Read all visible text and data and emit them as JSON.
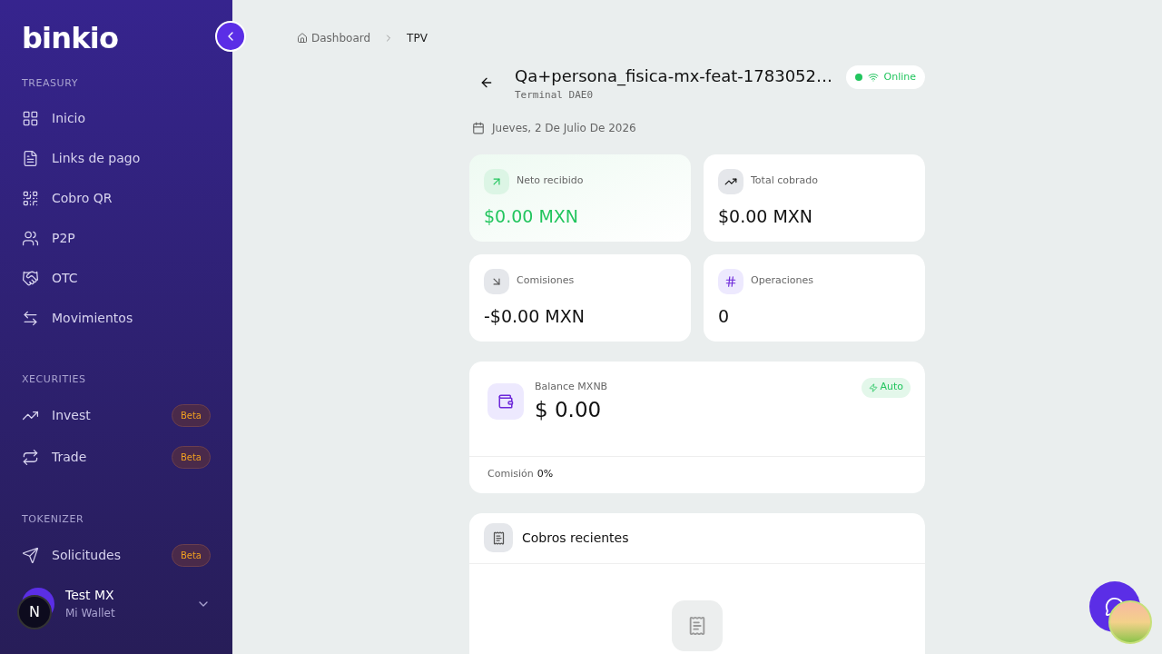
{
  "sidebar": {
    "logo": "binkio",
    "sections": [
      {
        "title": "TREASURY",
        "items": [
          {
            "label": "Inicio"
          },
          {
            "label": "Links de pago"
          },
          {
            "label": "Cobro QR"
          },
          {
            "label": "P2P"
          },
          {
            "label": "OTC"
          },
          {
            "label": "Movimientos"
          }
        ]
      },
      {
        "title": "XECURITIES",
        "items": [
          {
            "label": "Invest",
            "badge": "Beta"
          },
          {
            "label": "Trade",
            "badge": "Beta"
          }
        ]
      },
      {
        "title": "TOKENIZER",
        "items": [
          {
            "label": "Solicitudes",
            "badge": "Beta"
          }
        ]
      }
    ],
    "user": {
      "name": "Test MX",
      "subtitle": "Mi Wallet"
    },
    "dev_badge": "N"
  },
  "breadcrumb": [
    {
      "label": "Dashboard"
    },
    {
      "label": "TPV"
    }
  ],
  "header": {
    "title": "Qa+persona_fisica-mx-feat-1783052…",
    "subtitle": "Terminal DAE0",
    "status": "Online",
    "online": true
  },
  "date": "Jueves, 2 De Julio De 2026",
  "stats": [
    {
      "label": "Neto recibido",
      "value": "$0.00 MXN",
      "kind": "positive"
    },
    {
      "label": "Total cobrado",
      "value": "$0.00 MXN",
      "kind": "total"
    },
    {
      "label": "Comisiones",
      "value": "-$0.00 MXN",
      "kind": "fee"
    },
    {
      "label": "Operaciones",
      "value": "0",
      "kind": "count"
    }
  ],
  "balance": {
    "label": "Balance MXNB",
    "value": "$ 0.00",
    "badge": "Auto",
    "fee_label": "Comisión",
    "fee_value": "0%"
  },
  "recent": {
    "title": "Cobros recientes"
  }
}
